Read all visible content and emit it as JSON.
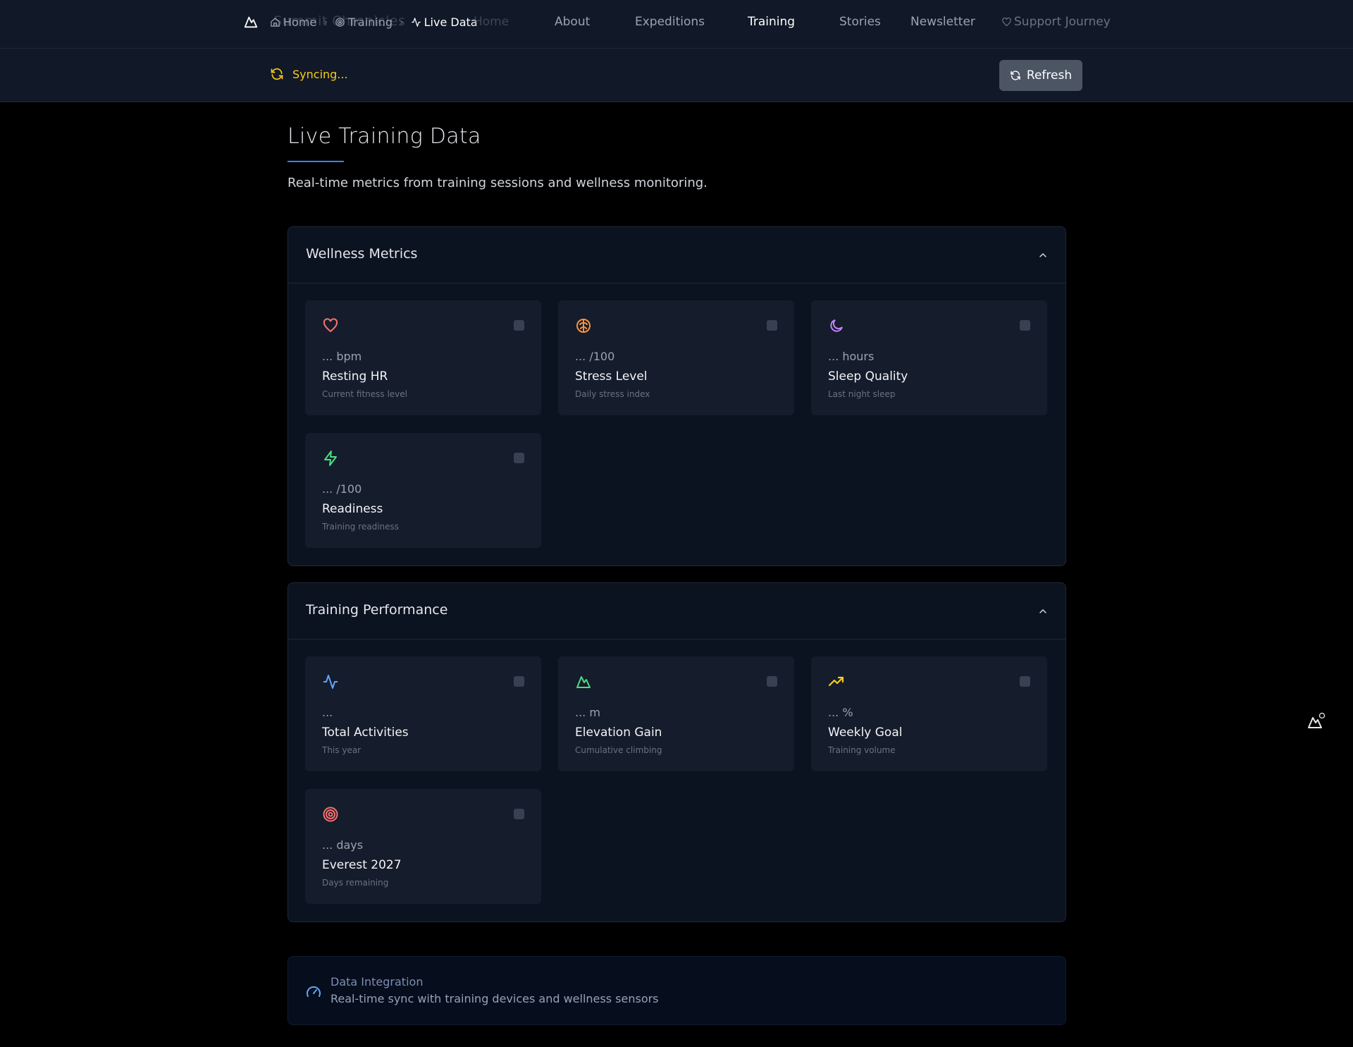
{
  "colors": {
    "accent": "#3b82f6",
    "syncing": "#facc15",
    "heart": "#f87171",
    "brain": "#fb923c",
    "moon": "#c084fc",
    "bolt": "#4ade80",
    "activity": "#60a5fa",
    "mountain": "#4ade80",
    "trend": "#facc15",
    "target": "#f87171"
  },
  "nav": {
    "brand": "Summit Chronicles",
    "breadcrumbs": [
      {
        "label": "Home",
        "icon": "home-icon"
      },
      {
        "label": "Training",
        "icon": "target-icon"
      },
      {
        "label": "Live Data",
        "icon": "activity-icon"
      }
    ],
    "links": [
      "Home",
      "About",
      "Expeditions",
      "Training",
      "Stories",
      "Newsletter"
    ],
    "active_link": "Training",
    "support": "Support Journey"
  },
  "sync": {
    "status": "Syncing...",
    "refresh_label": "Refresh"
  },
  "header": {
    "title": "Live Training Data",
    "subtitle": "Real-time metrics from training sessions and wellness monitoring."
  },
  "wellness": {
    "title": "Wellness Metrics",
    "cards": [
      {
        "icon": "heart-icon",
        "value": "... bpm",
        "label": "Resting HR",
        "desc": "Current fitness level"
      },
      {
        "icon": "brain-icon",
        "value": "... /100",
        "label": "Stress Level",
        "desc": "Daily stress index"
      },
      {
        "icon": "moon-icon",
        "value": "... hours",
        "label": "Sleep Quality",
        "desc": "Last night sleep"
      },
      {
        "icon": "lightning-icon",
        "value": "... /100",
        "label": "Readiness",
        "desc": "Training readiness"
      }
    ]
  },
  "performance": {
    "title": "Training Performance",
    "cards": [
      {
        "icon": "activity-icon",
        "value": "...",
        "label": "Total Activities",
        "desc": "This year"
      },
      {
        "icon": "mountain-icon",
        "value": "... m",
        "label": "Elevation Gain",
        "desc": "Cumulative climbing"
      },
      {
        "icon": "trending-up-icon",
        "value": "... %",
        "label": "Weekly Goal",
        "desc": "Training volume"
      },
      {
        "icon": "target-icon",
        "value": "... days",
        "label": "Everest 2027",
        "desc": "Days remaining"
      }
    ]
  },
  "integration": {
    "title": "Data Integration",
    "text": "Real-time sync with training devices and wellness sensors"
  }
}
